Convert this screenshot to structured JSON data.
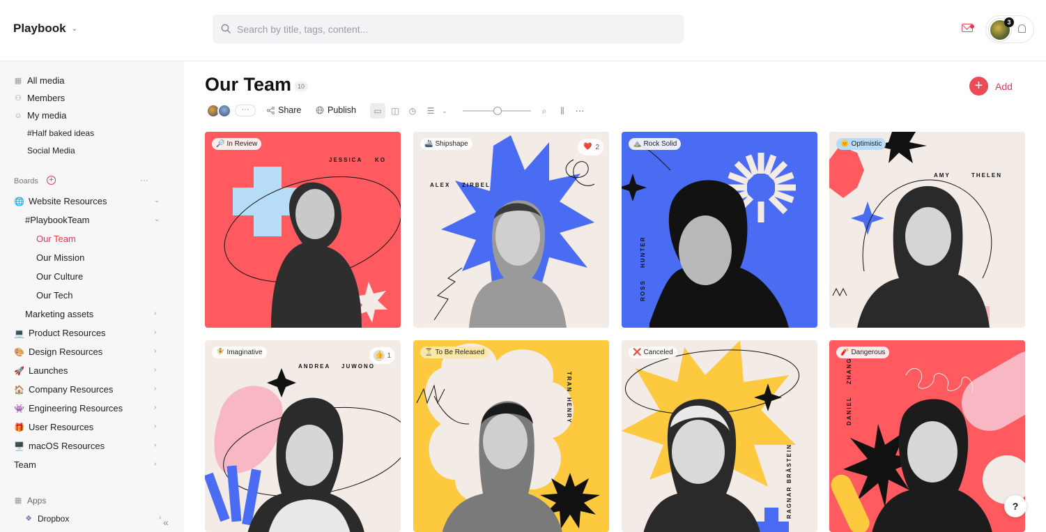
{
  "app": {
    "name": "Playbook"
  },
  "search": {
    "placeholder": "Search by title, tags, content..."
  },
  "header": {
    "notification_count": "3"
  },
  "sidebar": {
    "top_items": [
      {
        "label": "All media",
        "icon": "grid-icon"
      },
      {
        "label": "Members",
        "icon": "person-icon"
      },
      {
        "label": "My media",
        "icon": "smile-icon"
      },
      {
        "label": "#Half baked ideas"
      },
      {
        "label": "Social Media"
      }
    ],
    "boards_label": "Boards",
    "boards": [
      {
        "label": "Website Resources",
        "emoji": "🌐"
      },
      {
        "label": "#PlaybookTeam"
      },
      {
        "label": "Our Team",
        "active": true
      },
      {
        "label": "Our Mission"
      },
      {
        "label": "Our Culture"
      },
      {
        "label": "Our Tech"
      },
      {
        "label": "Marketing assets"
      },
      {
        "label": "Product Resources",
        "emoji": "💻"
      },
      {
        "label": "Design Resources",
        "emoji": "🎨"
      },
      {
        "label": "Launches",
        "emoji": "🚀"
      },
      {
        "label": "Company Resources",
        "emoji": "🏠"
      },
      {
        "label": "Engineering Resources",
        "emoji": "👾"
      },
      {
        "label": "User Resources",
        "emoji": "🎁"
      },
      {
        "label": "macOS Resources",
        "emoji": "🖥️"
      },
      {
        "label": "Team"
      }
    ],
    "apps_label": "Apps",
    "apps": [
      {
        "label": "Dropbox"
      }
    ]
  },
  "page": {
    "title": "Our Team",
    "count": "10",
    "add_label": "Add",
    "share_label": "Share",
    "publish_label": "Publish",
    "more_label": "···"
  },
  "colors": {
    "accent": "#e8344a",
    "red": "#ff5a5f",
    "blue": "#4a6cf2",
    "cream": "#f3ebe6",
    "yellow": "#fcc93f",
    "pink": "#f7b8c3",
    "lightblue": "#b7dcf7"
  },
  "cards": [
    {
      "tag": "In Review",
      "tag_icon": "🔎",
      "first": "JESSICA",
      "last": "KO"
    },
    {
      "tag": "Shipshape",
      "tag_icon": "🚢",
      "first": "ALEX",
      "last": "ZIRBEL",
      "reaction": "❤️",
      "reaction_count": "2"
    },
    {
      "tag": "Rock Solid",
      "tag_icon": "⛰️",
      "first": "ROSS",
      "last": "HUNTER"
    },
    {
      "tag": "Optimistic",
      "tag_icon": "🌞",
      "first": "AMY",
      "last": "THELEN"
    },
    {
      "tag": "Imaginative",
      "tag_icon": "🧚",
      "first": "ANDREA",
      "last": "JUWONO",
      "reaction": "👍",
      "reaction_count": "1"
    },
    {
      "tag": "To Be Released",
      "tag_icon": "⏳",
      "first": "HENRY",
      "last": "TRAN"
    },
    {
      "tag": "Canceled",
      "tag_icon": "❌",
      "first": "RAGNAR",
      "last": "BRÅSTEIN"
    },
    {
      "tag": "Dangerous",
      "tag_icon": "🧨",
      "first": "DANIEL",
      "last": "ZHANG"
    }
  ],
  "help_label": "?"
}
